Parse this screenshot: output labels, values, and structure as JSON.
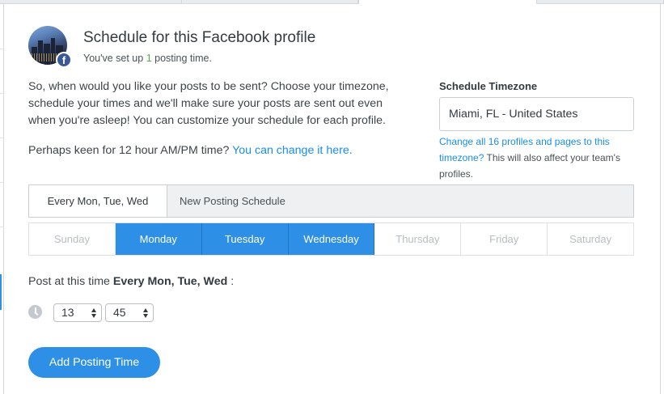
{
  "header": {
    "title": "Schedule for this Facebook profile",
    "subtitle_prefix": "You've set up ",
    "posting_time_count": "1",
    "subtitle_suffix": " posting time."
  },
  "intro": {
    "text": "So, when would you like your posts to be sent? Choose your timezone, schedule your times and we'll make sure your posts are sent out even when you're asleep! You can customize your schedule for each profile.",
    "hour_prefix": "Perhaps keen for 12 hour AM/PM time? ",
    "hour_link": "You can change it here."
  },
  "timezone": {
    "label": "Schedule Timezone",
    "value": "Miami, FL - United States",
    "change_link": "Change all 16 profiles and pages to this timezone?",
    "note": " This will also affect your team's profiles."
  },
  "schedule_tabs": [
    {
      "label": "Every Mon, Tue, Wed",
      "active": true
    },
    {
      "label": "New Posting Schedule",
      "active": false
    }
  ],
  "days": [
    {
      "label": "Sunday",
      "selected": false
    },
    {
      "label": "Monday",
      "selected": true
    },
    {
      "label": "Tuesday",
      "selected": true
    },
    {
      "label": "Wednesday",
      "selected": true
    },
    {
      "label": "Thursday",
      "selected": false
    },
    {
      "label": "Friday",
      "selected": false
    },
    {
      "label": "Saturday",
      "selected": false
    }
  ],
  "post_time": {
    "label_prefix": "Post at this time ",
    "label_bold": "Every Mon, Tue, Wed",
    "label_suffix": " :",
    "hour": "13",
    "minute": "45"
  },
  "add_button": "Add Posting Time",
  "colors": {
    "accent": "#2d8fe6",
    "link": "#168eea",
    "count_green": "#52b24a",
    "facebook": "#3b5998"
  },
  "icons": {
    "avatar": "profile-avatar",
    "badge": "facebook-icon",
    "clock": "clock-icon",
    "select_arrows": "select-arrows-icon"
  }
}
